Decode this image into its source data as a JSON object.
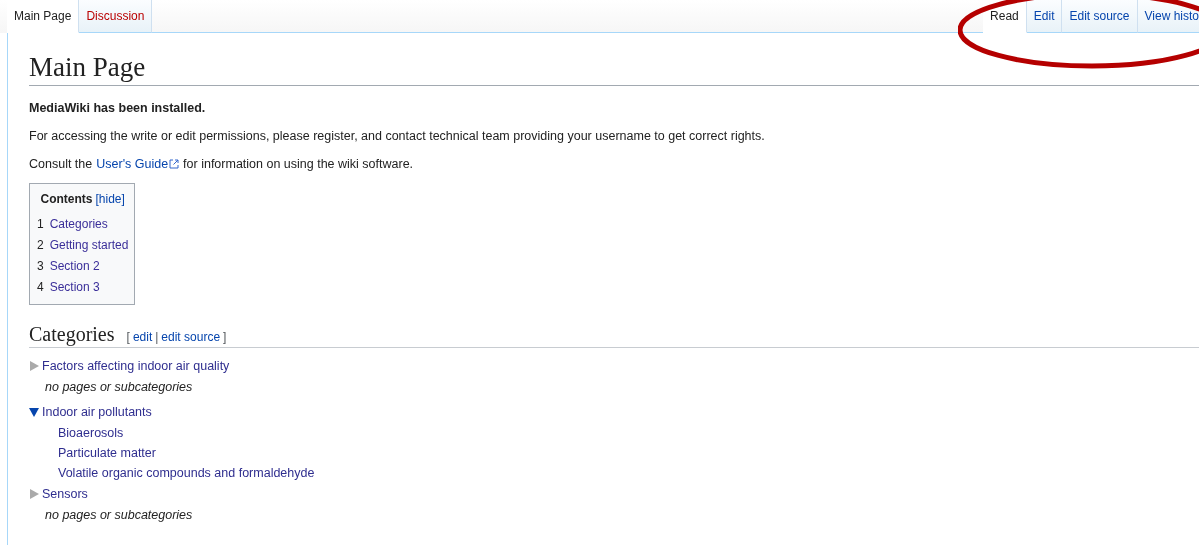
{
  "left_tabs": [
    {
      "label": "Main Page",
      "selected": true
    },
    {
      "label": "Discussion",
      "selected": false,
      "kind": "new"
    }
  ],
  "right_tabs": [
    {
      "label": "Read",
      "selected": true
    },
    {
      "label": "Edit",
      "selected": false
    },
    {
      "label": "Edit source",
      "selected": false
    },
    {
      "label": "View histo",
      "selected": false
    }
  ],
  "title": "Main Page",
  "notice": "MediaWiki has been installed.",
  "paragraph": "For accessing the write or edit permissions, please register, and contact technical team providing your username to get correct rights.",
  "guide": {
    "before": "Consult the",
    "link": "User's Guide",
    "after": "for information on using the wiki software."
  },
  "toc": {
    "title": "Contents",
    "toggle": "[hide]",
    "items": [
      {
        "number": "1",
        "label": "Categories"
      },
      {
        "number": "2",
        "label": "Getting started"
      },
      {
        "number": "3",
        "label": "Section 2"
      },
      {
        "number": "4",
        "label": "Section 3"
      }
    ]
  },
  "section": {
    "heading": "Categories",
    "edit_links": {
      "open": "[",
      "edit": "edit",
      "separator": "|",
      "edit_source": "edit source",
      "close": "]"
    }
  },
  "categories": [
    {
      "label": "Factors affecting indoor air quality",
      "expanded": false,
      "note": "no pages or subcategories"
    },
    {
      "label": "Indoor air pollutants",
      "expanded": true,
      "children": [
        {
          "label": "Bioaerosols"
        },
        {
          "label": "Particulate matter"
        },
        {
          "label": "Volatile organic compounds and formaldehyde"
        }
      ]
    },
    {
      "label": "Sensors",
      "expanded": false,
      "note": "no pages or subcategories"
    }
  ],
  "annotations": [
    {
      "kind": "ellipse"
    }
  ]
}
